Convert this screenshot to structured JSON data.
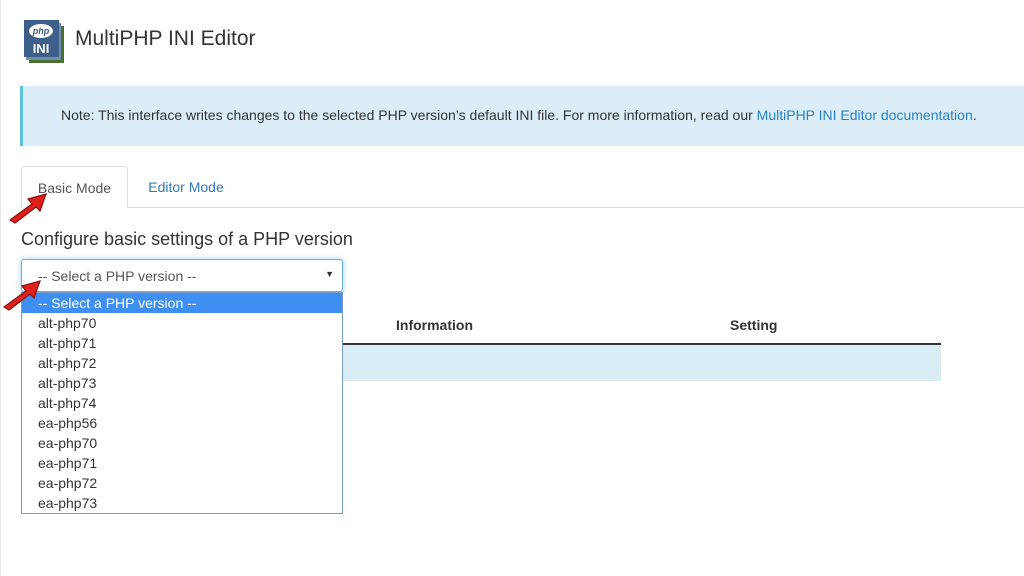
{
  "header": {
    "title": "MultiPHP INI Editor",
    "icon": {
      "name": "php-ini-icon",
      "top_text": "php",
      "bottom_text": "INI"
    }
  },
  "note": {
    "text": "Note: This interface writes changes to the selected PHP version’s default INI file. For more information, read our ",
    "link_text": "MultiPHP INI Editor documentation",
    "suffix": "."
  },
  "tabs": [
    {
      "label": "Basic Mode",
      "active": true
    },
    {
      "label": "Editor Mode",
      "active": false
    }
  ],
  "section": {
    "heading": "Configure basic settings of a PHP version"
  },
  "php_select": {
    "value": "-- Select a PHP version --",
    "options": [
      "-- Select a PHP version --",
      "alt-php70",
      "alt-php71",
      "alt-php72",
      "alt-php73",
      "alt-php74",
      "ea-php56",
      "ea-php70",
      "ea-php71",
      "ea-php72",
      "ea-php73"
    ]
  },
  "table": {
    "columns": [
      "Information",
      "Setting"
    ]
  },
  "colors": {
    "link": "#2a82c6",
    "note_bg": "#dbedf6",
    "selected_option_bg": "#3f8ff3",
    "arrow": "#e0201c"
  }
}
